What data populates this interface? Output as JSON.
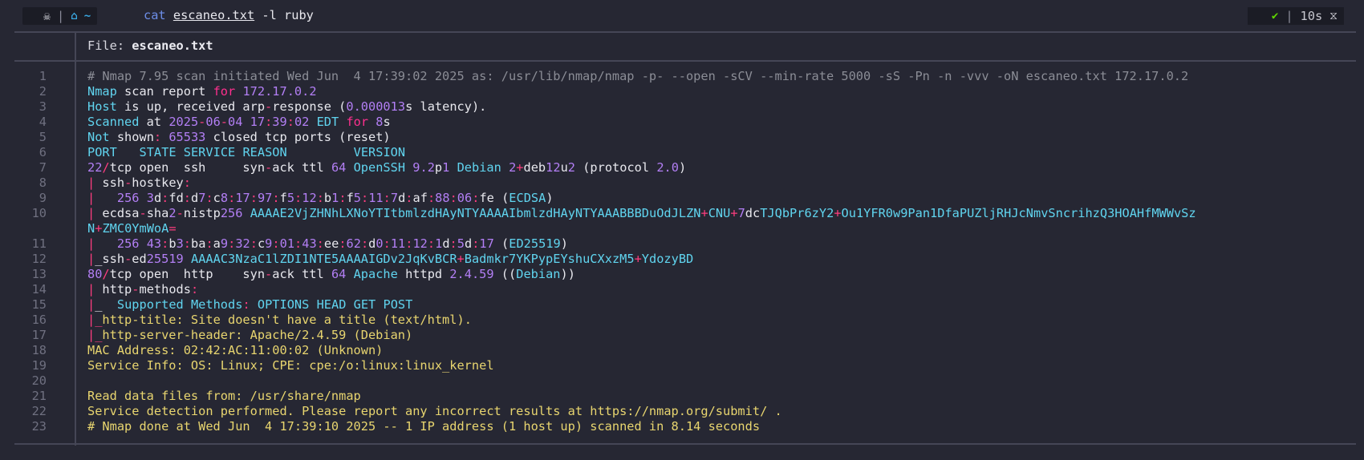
{
  "prompt": {
    "os_glyph": "☠",
    "separator": "|",
    "home_glyph": "⌂",
    "tilde": "~",
    "command": "cat",
    "argument": "escaneo.txt",
    "flags": "-l ruby",
    "status_glyph": "✔",
    "duration": "10s",
    "timer_glyph": "⧖"
  },
  "file": {
    "label": "File:",
    "name": "escaneo.txt"
  },
  "line_numbers": [
    "1",
    "2",
    "3",
    "4",
    "5",
    "6",
    "7",
    "8",
    "9",
    "10",
    "11",
    "12",
    "13",
    "14",
    "15",
    "16",
    "17",
    "18",
    "19",
    "20",
    "21",
    "22",
    "23"
  ],
  "lines": [
    {
      "t": "# Nmap 7.95 scan initiated Wed Jun  4 17:39:02 2025 as: /usr/lib/nmap/nmap -p- --open -sCV --min-rate 5000 -sS -Pn -n -vvv -oN escaneo.txt 172.17.0.2"
    },
    {
      "t": "Nmap scan report for 172.17.0.2"
    },
    {
      "t": "Host is up, received arp-response (0.000013s latency)."
    },
    {
      "t": "Scanned at 2025-06-04 17:39:02 EDT for 8s"
    },
    {
      "t": "Not shown: 65533 closed tcp ports (reset)"
    },
    {
      "t": "PORT   STATE SERVICE REASON         VERSION"
    },
    {
      "t": "22/tcp open  ssh     syn-ack ttl 64 OpenSSH 9.2p1 Debian 2+deb12u2 (protocol 2.0)"
    },
    {
      "t": "| ssh-hostkey: "
    },
    {
      "t": "|   256 3d:fd:d7:c8:17:97:f5:12:b1:f5:11:7d:af:88:06:fe (ECDSA)"
    },
    {
      "t": "| ecdsa-sha2-nistp256 AAAAE2VjZHNhLXNoYTItbmlzdHAyNTYAAAAIbmlzdHAyNTYAAABBBDuOdJLZN+CNU+7dcTJQbPr6zY2+Ou1YFR0w9Pan1DfaPUZljRHJcNmvSncrihzQ3HOAHfMWWvSzN+ZMC0YmWoA="
    },
    {
      "t": "|   256 43:b3:ba:a9:32:c9:01:43:ee:62:d0:11:12:1d:5d:17 (ED25519)"
    },
    {
      "t": "|_ssh-ed25519 AAAAC3NzaC1lZDI1NTE5AAAAIGDv2JqKvBCR+Badmkr7YKPypEYshuCXxzM5+YdozyBD"
    },
    {
      "t": "80/tcp open  http    syn-ack ttl 64 Apache httpd 2.4.59 ((Debian))"
    },
    {
      "t": "| http-methods: "
    },
    {
      "t": "|_  Supported Methods: OPTIONS HEAD GET POST"
    },
    {
      "t": "|_http-title: Site doesn't have a title (text/html)."
    },
    {
      "t": "|_http-server-header: Apache/2.4.59 (Debian)"
    },
    {
      "t": "MAC Address: 02:42:AC:11:00:02 (Unknown)"
    },
    {
      "t": "Service Info: OS: Linux; CPE: cpe:/o:linux:linux_kernel"
    },
    {
      "t": ""
    },
    {
      "t": "Read data files from: /usr/share/nmap"
    },
    {
      "t": "Service detection performed. Please report any incorrect results at https://nmap.org/submit/ ."
    },
    {
      "t": "# Nmap done at Wed Jun  4 17:39:10 2025 -- 1 IP address (1 host up) scanned in 8.14 seconds"
    }
  ],
  "colors": {
    "background": "#262733",
    "comment": "#8b8d96",
    "keyword": "#ff2f8e",
    "number": "#b37ff5",
    "constant": "#60d4ef",
    "string": "#e8d56f",
    "accent_green": "#a8e22f"
  }
}
